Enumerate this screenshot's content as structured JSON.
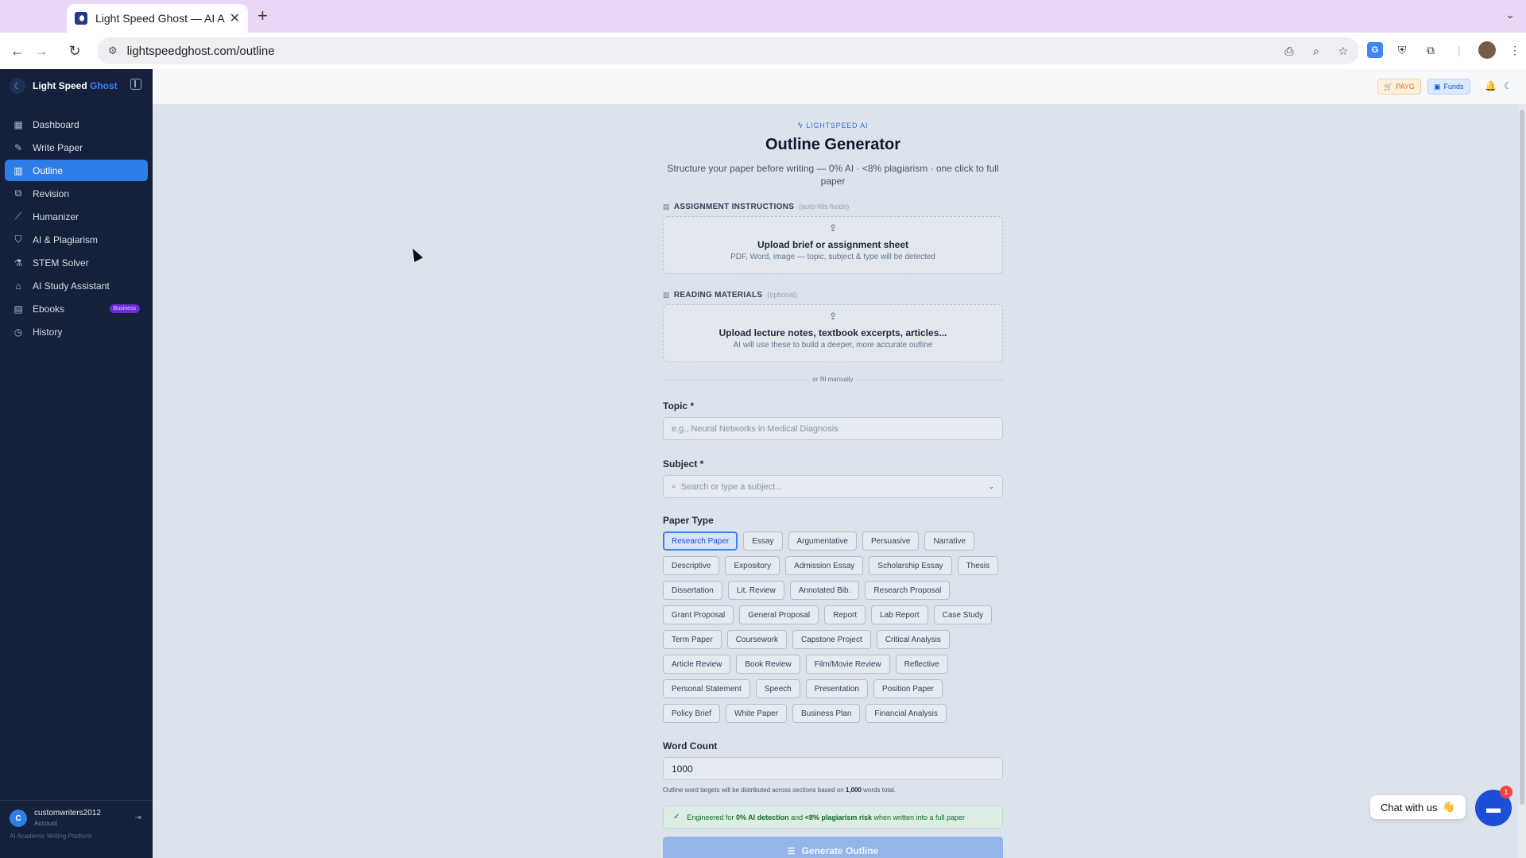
{
  "browser": {
    "tab_title": "Light Speed Ghost — AI Acad",
    "url": "lightspeedghost.com/outline"
  },
  "sidebar": {
    "brand_main": "Light Speed",
    "brand_accent": "Ghost",
    "items": [
      {
        "label": "Dashboard",
        "icon": "grid-icon"
      },
      {
        "label": "Write Paper",
        "icon": "pen-icon"
      },
      {
        "label": "Outline",
        "icon": "book-icon",
        "active": true
      },
      {
        "label": "Revision",
        "icon": "copy-icon"
      },
      {
        "label": "Humanizer",
        "icon": "wand-icon"
      },
      {
        "label": "AI & Plagiarism",
        "icon": "shield-icon"
      },
      {
        "label": "STEM Solver",
        "icon": "flask-icon"
      },
      {
        "label": "AI Study Assistant",
        "icon": "graduation-cap-icon"
      },
      {
        "label": "Ebooks",
        "icon": "ebook-icon",
        "badge": "Business"
      },
      {
        "label": "History",
        "icon": "history-icon"
      }
    ],
    "user": {
      "initial": "C",
      "name": "customwriters2012",
      "role": "Account"
    },
    "platform_label": "AI Academic Writing Platform"
  },
  "header": {
    "payg_label": "PAYG",
    "funds_label": "Funds"
  },
  "page": {
    "eyebrow": "LIGHTSPEED AI",
    "title": "Outline Generator",
    "subtitle": "Structure your paper before writing — 0% AI · <8% plagiarism · one click to full paper"
  },
  "assignment": {
    "label": "ASSIGNMENT INSTRUCTIONS",
    "hint": "(auto-fills fields)",
    "upload_title": "Upload brief or assignment sheet",
    "upload_sub": "PDF, Word, image — topic, subject & type will be detected"
  },
  "reading": {
    "label": "READING MATERIALS",
    "hint": "(optional)",
    "upload_title": "Upload lecture notes, textbook excerpts, articles...",
    "upload_sub": "AI will use these to build a deeper, more accurate outline"
  },
  "divider_text": "or fill manually",
  "topic": {
    "label": "Topic *",
    "placeholder": "e.g., Neural Networks in Medical Diagnosis"
  },
  "subject": {
    "label": "Subject *",
    "placeholder": "Search or type a subject..."
  },
  "paper_type": {
    "label": "Paper Type",
    "selected": "Research Paper",
    "options": [
      "Research Paper",
      "Essay",
      "Argumentative",
      "Persuasive",
      "Narrative",
      "Descriptive",
      "Expository",
      "Admission Essay",
      "Scholarship Essay",
      "Thesis",
      "Dissertation",
      "Lit. Review",
      "Annotated Bib.",
      "Research Proposal",
      "Grant Proposal",
      "General Proposal",
      "Report",
      "Lab Report",
      "Case Study",
      "Term Paper",
      "Coursework",
      "Capstone Project",
      "Critical Analysis",
      "Article Review",
      "Book Review",
      "Film/Movie Review",
      "Reflective",
      "Personal Statement",
      "Speech",
      "Presentation",
      "Position Paper",
      "Policy Brief",
      "White Paper",
      "Business Plan",
      "Financial Analysis"
    ]
  },
  "word_count": {
    "label": "Word Count",
    "value": "1000",
    "note_pre": "Outline word targets will be distributed across sections based on ",
    "note_bold": "1,000",
    "note_post": " words total."
  },
  "assurance": {
    "pre": "Engineered for ",
    "b1": "0% AI detection",
    "mid": " and ",
    "b2": "<8% plagiarism risk",
    "post": " when written into a full paper"
  },
  "generate_label": "Generate Outline",
  "chat": {
    "label": "Chat with us",
    "emoji": "👋",
    "count": "1"
  }
}
